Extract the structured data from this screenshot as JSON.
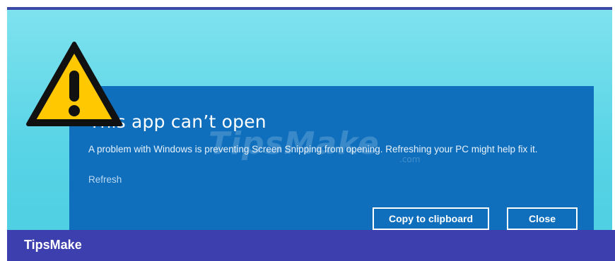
{
  "dialog": {
    "title": "This app can’t open",
    "message": "A problem with Windows is preventing Screen Snipping from opening. Refreshing your PC might help fix it.",
    "refresh_link": "Refresh",
    "buttons": {
      "copy_label": "Copy to clipboard",
      "close_label": "Close"
    },
    "background_color": "#0f6fbd"
  },
  "watermark": {
    "text": "TipsMake",
    "domain": ".com"
  },
  "footer": {
    "brand": "TipsMake",
    "background_color": "#3d3faf"
  },
  "icons": {
    "warning": "warning-triangle-icon"
  },
  "colors": {
    "desktop_background": "#5fd6e8",
    "warning_fill": "#ffc800",
    "warning_outline": "#111111"
  }
}
